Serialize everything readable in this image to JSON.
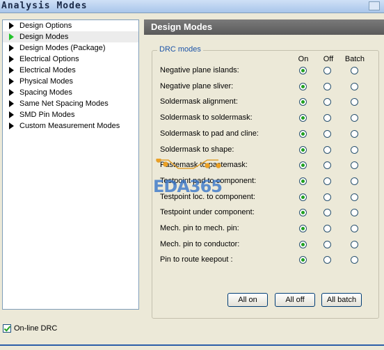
{
  "window": {
    "title": "Analysis Modes"
  },
  "tree": {
    "items": [
      {
        "label": "Design Options",
        "selected": false
      },
      {
        "label": "Design Modes",
        "selected": true
      },
      {
        "label": "Design Modes (Package)",
        "selected": false
      },
      {
        "label": "Electrical Options",
        "selected": false
      },
      {
        "label": "Electrical Modes",
        "selected": false
      },
      {
        "label": "Physical Modes",
        "selected": false
      },
      {
        "label": "Spacing Modes",
        "selected": false
      },
      {
        "label": "Same Net Spacing Modes",
        "selected": false
      },
      {
        "label": "SMD Pin Modes",
        "selected": false
      },
      {
        "label": "Custom Measurement Modes",
        "selected": false
      }
    ]
  },
  "panel": {
    "title": "Design Modes",
    "group_label": "DRC modes",
    "columns": [
      "On",
      "Off",
      "Batch"
    ],
    "rows": [
      {
        "label": "Negative plane islands:",
        "selected": "On"
      },
      {
        "label": "Negative plane sliver:",
        "selected": "On"
      },
      {
        "label": "Soldermask alignment:",
        "selected": "On"
      },
      {
        "label": "Soldermask to soldermask:",
        "selected": "On"
      },
      {
        "label": "Soldermask to pad and cline:",
        "selected": "On"
      },
      {
        "label": "Soldermask to shape:",
        "selected": "On"
      },
      {
        "label": "Pastemask to pastemask:",
        "selected": "On"
      },
      {
        "label": "Testpoint pad to component:",
        "selected": "On"
      },
      {
        "label": "Testpoint loc. to component:",
        "selected": "On"
      },
      {
        "label": "Testpoint under component:",
        "selected": "On"
      },
      {
        "label": "Mech. pin to mech. pin:",
        "selected": "On"
      },
      {
        "label": "Mech. pin to conductor:",
        "selected": "On"
      },
      {
        "label": "Pin to route keepout :",
        "selected": "On"
      }
    ],
    "buttons": {
      "all_on": "All on",
      "all_off": "All off",
      "all_batch": "All batch"
    }
  },
  "footer": {
    "online_drc_label": "On-line DRC",
    "online_drc_checked": true
  },
  "watermark": {
    "text": "EDA365"
  },
  "colors": {
    "accent_green": "#21a121",
    "header_gray": "#666666",
    "link_blue": "#1c54a8"
  }
}
